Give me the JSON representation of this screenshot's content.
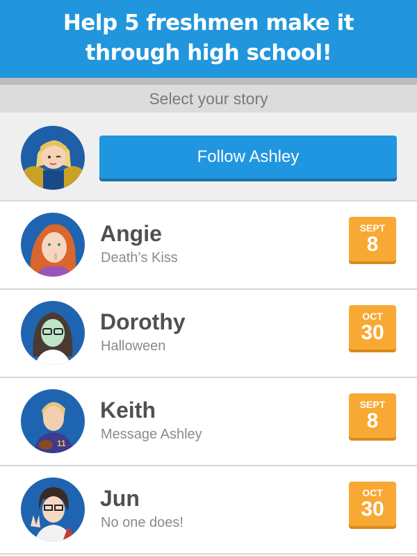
{
  "banner": {
    "line1": "Help 5 freshmen make it",
    "line2": "through high school!"
  },
  "subheader": {
    "label": "Select your story"
  },
  "follow": {
    "button_label": "Follow Ashley",
    "avatar_icon": "ashley-cheerleader-avatar"
  },
  "stories": [
    {
      "name": "Angie",
      "subtitle": "Death’s Kiss",
      "month": "SEPT",
      "day": "8",
      "avatar_icon": "angie-avatar"
    },
    {
      "name": "Dorothy",
      "subtitle": "Halloween",
      "month": "OCT",
      "day": "30",
      "avatar_icon": "dorothy-avatar"
    },
    {
      "name": "Keith",
      "subtitle": "Message Ashley",
      "month": "SEPT",
      "day": "8",
      "avatar_icon": "keith-avatar"
    },
    {
      "name": "Jun",
      "subtitle": "No one does!",
      "month": "OCT",
      "day": "30",
      "avatar_icon": "jun-avatar"
    }
  ],
  "colors": {
    "banner": "#2196dc",
    "button": "#2196e0",
    "badge": "#f8a934"
  }
}
